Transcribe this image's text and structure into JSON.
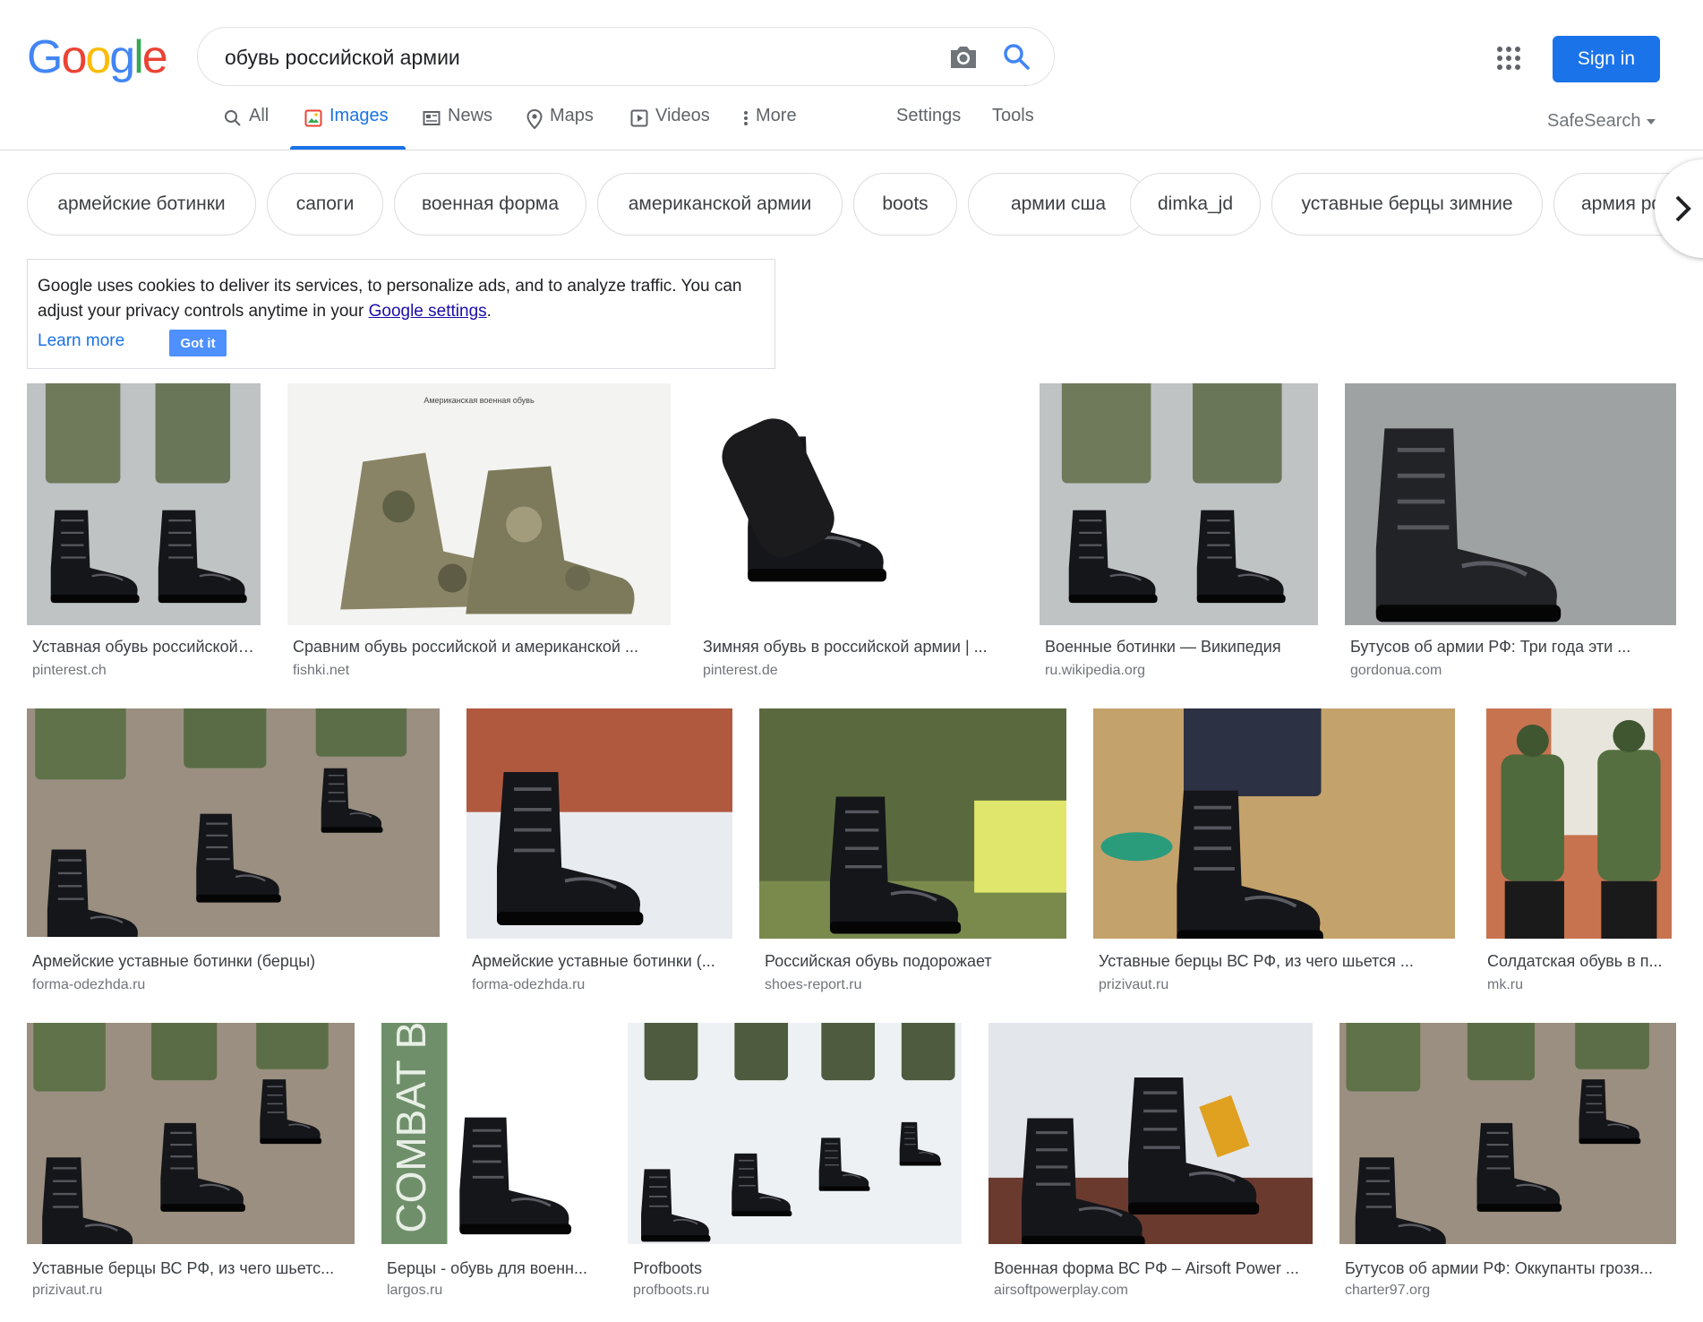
{
  "search": {
    "query": "обувь российской армии"
  },
  "header": {
    "sign_in": "Sign in"
  },
  "tabs": [
    {
      "label": "All",
      "icon": "search-icon"
    },
    {
      "label": "Images",
      "icon": "image-icon",
      "active": true
    },
    {
      "label": "News",
      "icon": "news-icon"
    },
    {
      "label": "Maps",
      "icon": "map-pin-icon"
    },
    {
      "label": "Videos",
      "icon": "video-icon"
    },
    {
      "label": "More",
      "icon": "more-vert-icon"
    }
  ],
  "tools": {
    "settings": "Settings",
    "tools": "Tools",
    "safesearch": "SafeSearch"
  },
  "chips": [
    "армейские ботинки",
    "сапоги",
    "военная форма",
    "американской армии",
    "boots",
    "армии сша",
    "dimka_jd",
    "уставные берцы зимние",
    "армия рф"
  ],
  "cookie": {
    "text_before": "Google uses cookies to deliver its services, to personalize ads, and to analyze traffic. You can adjust your privacy controls anytime in your ",
    "link": "Google settings",
    "text_after": ".",
    "learn_more": "Learn more",
    "got_it": "Got it"
  },
  "results": [
    {
      "title": "Уставная обувь российской армии",
      "source": "pinterest.ch",
      "scene": "legs"
    },
    {
      "title": "Сравним обувь российской и американской ...",
      "source": "fishki.net",
      "scene": "camo",
      "caption": "Американская военная обувь"
    },
    {
      "title": "Зимняя обувь в российской армии | ...",
      "source": "pinterest.de",
      "scene": "product"
    },
    {
      "title": "Военные ботинки — Википедия",
      "source": "ru.wikipedia.org",
      "scene": "legs"
    },
    {
      "title": "Бутусов об армии РФ: Три года эти ...",
      "source": "gordonua.com",
      "scene": "worn"
    },
    {
      "title": "Армейские уставные ботинки (берцы)",
      "source": "forma-odezhda.ru",
      "scene": "ground"
    },
    {
      "title": "Армейские уставные ботинки (...",
      "source": "forma-odezhda.ru",
      "scene": "snow"
    },
    {
      "title": "Российская обувь подорожает",
      "source": "shoes-report.ru",
      "scene": "store"
    },
    {
      "title": "Уставные берцы ВС РФ, из чего шьется ...",
      "source": "prizivaut.ru",
      "scene": "floor"
    },
    {
      "title": "Солдатская обувь в п...",
      "source": "mk.ru",
      "scene": "soldiers"
    },
    {
      "title": "Уставные берцы ВС РФ, из чего шьетс...",
      "source": "prizivaut.ru",
      "scene": "ground"
    },
    {
      "title": "Берцы - обувь для военн...",
      "source": "largos.ru",
      "scene": "ad",
      "caption": "COMBAT BO"
    },
    {
      "title": "Profboots",
      "source": "profboots.ru",
      "scene": "snowrow"
    },
    {
      "title": "Военная форма ВС РФ – Airsoft Power ...",
      "source": "airsoftpowerplay.com",
      "scene": "redtable"
    },
    {
      "title": "Бутусов об армии РФ: Оккупанты грозя...",
      "source": "charter97.org",
      "scene": "ground"
    }
  ]
}
